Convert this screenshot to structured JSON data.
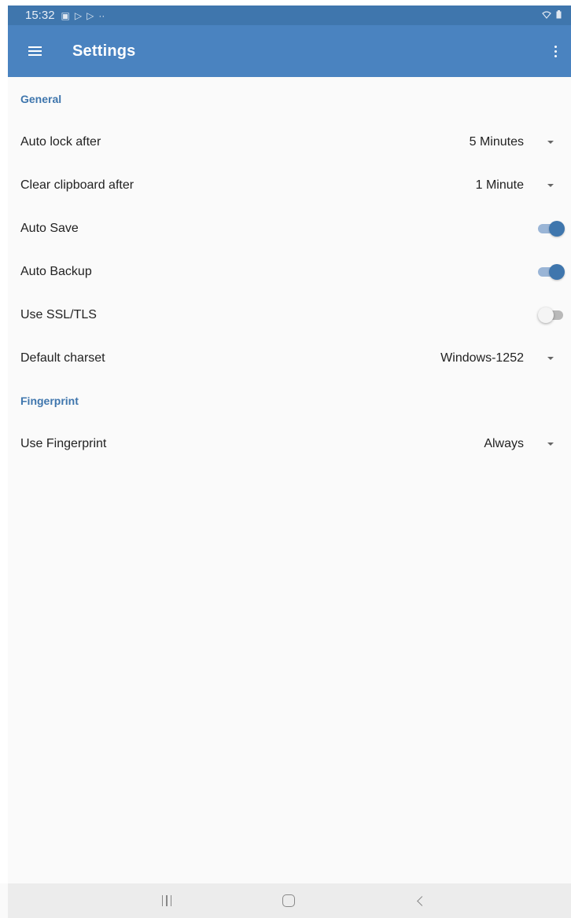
{
  "status_bar": {
    "time": "15:32",
    "left_icons": [
      "gallery-icon",
      "play-store-icon",
      "play-store-icon",
      "more-notifications-icon"
    ],
    "right_icons": [
      "wifi-icon",
      "battery-icon"
    ]
  },
  "toolbar": {
    "title": "Settings",
    "menu_icon": "hamburger-icon",
    "overflow_icon": "more-vert-icon"
  },
  "sections": {
    "general": {
      "header": "General",
      "auto_lock": {
        "label": "Auto lock after",
        "value": "5 Minutes"
      },
      "clear_clipboard": {
        "label": "Clear clipboard after",
        "value": "1 Minute"
      },
      "auto_save": {
        "label": "Auto Save",
        "checked": true
      },
      "auto_backup": {
        "label": "Auto Backup",
        "checked": true
      },
      "use_ssl": {
        "label": "Use SSL/TLS",
        "checked": false
      },
      "default_charset": {
        "label": "Default charset",
        "value": "Windows-1252"
      }
    },
    "fingerprint": {
      "header": "Fingerprint",
      "use_fingerprint": {
        "label": "Use Fingerprint",
        "value": "Always"
      }
    }
  },
  "nav_bar": {
    "buttons": [
      "recents-icon",
      "home-icon",
      "back-icon"
    ]
  },
  "colors": {
    "status_bar": "#3f76ad",
    "toolbar": "#4a83c0",
    "accent": "#3f76ad",
    "background": "#fafafa",
    "nav_bar": "#ececec"
  }
}
